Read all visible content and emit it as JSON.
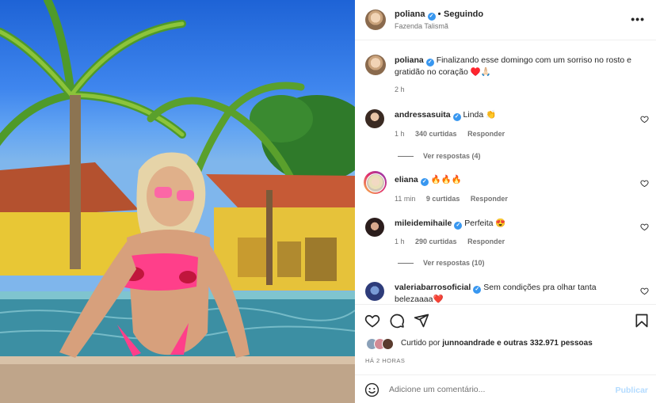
{
  "post": {
    "author": "poliana",
    "follow_status": "Seguindo",
    "separator": "•",
    "location": "Fazenda Talismã",
    "more_label": "•••"
  },
  "caption": {
    "username": "poliana",
    "text": "Finalizando esse domingo com um sorriso no rosto e gratidão no coração ♥️🙏🏻",
    "time": "2 h"
  },
  "comments": [
    {
      "username": "andressasuita",
      "text": "Linda 👏",
      "time": "1 h",
      "likes": "340 curtidas",
      "reply": "Responder",
      "view_replies": "Ver respostas (4)"
    },
    {
      "username": "eliana",
      "text": "🔥🔥🔥",
      "time": "11 min",
      "likes": "9 curtidas",
      "reply": "Responder"
    },
    {
      "username": "mileidemihaile",
      "text": "Perfeita 😍",
      "time": "1 h",
      "likes": "290 curtidas",
      "reply": "Responder",
      "view_replies": "Ver respostas (10)"
    },
    {
      "username": "valeriabarrosoficial",
      "text": "Sem condições pra olhar tanta belezaaaa❤️"
    }
  ],
  "likes": {
    "prefix": "Curtido por",
    "user": "junnoandrade",
    "suffix": "e outras 332.971 pessoas",
    "time_ago": "HÁ 2 HORAS"
  },
  "add_comment": {
    "placeholder": "Adicione um comentário...",
    "publish": "Publicar"
  },
  "colors": {
    "link_blue": "#3897f0",
    "publish_disabled": "#b3dbff",
    "muted_text": "#737373"
  },
  "icons": [
    "heart-icon",
    "comment-icon",
    "share-icon",
    "bookmark-icon",
    "emoji-icon",
    "verified-icon",
    "more-icon"
  ]
}
